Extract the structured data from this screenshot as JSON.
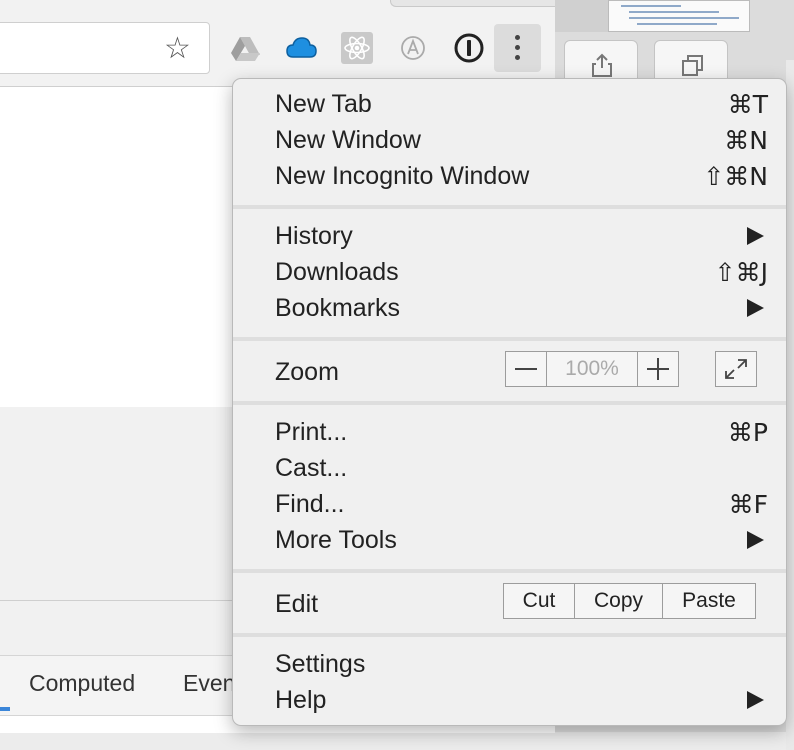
{
  "toolbar": {
    "extensions": [
      "google-drive-icon",
      "cloud-icon",
      "react-devtools-icon",
      "autofill-a-icon",
      "1password-icon"
    ],
    "menu_button": "more-vertical-icon"
  },
  "devtools": {
    "tabs": [
      "Computed",
      "Even"
    ]
  },
  "menu": {
    "new_tab": {
      "label": "New Tab",
      "shortcut": "⌘T"
    },
    "new_window": {
      "label": "New Window",
      "shortcut": "⌘N"
    },
    "new_incognito": {
      "label": "New Incognito Window",
      "shortcut": "⇧⌘N"
    },
    "history": {
      "label": "History"
    },
    "downloads": {
      "label": "Downloads",
      "shortcut": "⇧⌘J"
    },
    "bookmarks": {
      "label": "Bookmarks"
    },
    "zoom": {
      "label": "Zoom",
      "value": "100%"
    },
    "print": {
      "label": "Print...",
      "shortcut": "⌘P"
    },
    "cast": {
      "label": "Cast..."
    },
    "find": {
      "label": "Find...",
      "shortcut": "⌘F"
    },
    "more_tools": {
      "label": "More Tools"
    },
    "edit": {
      "label": "Edit",
      "cut": "Cut",
      "copy": "Copy",
      "paste": "Paste"
    },
    "settings": {
      "label": "Settings"
    },
    "help": {
      "label": "Help"
    }
  },
  "colors": {
    "menu_bg": "#f0f0f0",
    "separator": "#dedede",
    "active_tab_underline": "#3b86d9",
    "cloud_icon": "#1e8fe0"
  }
}
